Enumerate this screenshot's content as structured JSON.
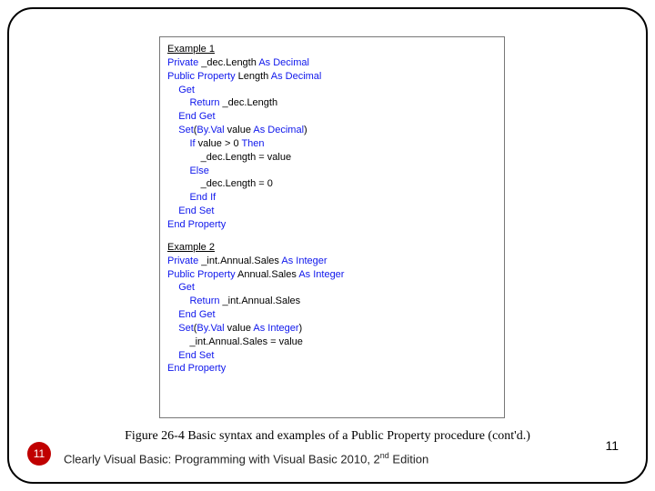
{
  "example1": {
    "heading": "Example 1",
    "lines": [
      [
        [
          "kw",
          "Private "
        ],
        [
          "",
          "_dec.Length "
        ],
        [
          "kw",
          "As Decimal"
        ]
      ],
      [
        [
          "",
          ""
        ]
      ],
      [
        [
          "kw",
          "Public Property "
        ],
        [
          "",
          "Length "
        ],
        [
          "kw",
          "As Decimal"
        ]
      ],
      [
        [
          "",
          "    "
        ],
        [
          "kw",
          "Get"
        ]
      ],
      [
        [
          "",
          "        "
        ],
        [
          "kw",
          "Return "
        ],
        [
          "",
          "_dec.Length"
        ]
      ],
      [
        [
          "",
          "    "
        ],
        [
          "kw",
          "End Get"
        ]
      ],
      [
        [
          "",
          "    "
        ],
        [
          "kw",
          "Set"
        ],
        [
          "",
          "("
        ],
        [
          "kw",
          "By.Val "
        ],
        [
          "",
          "value "
        ],
        [
          "kw",
          "As Decimal"
        ],
        [
          "",
          ")"
        ]
      ],
      [
        [
          "",
          "        "
        ],
        [
          "kw",
          "If "
        ],
        [
          "",
          "value > 0 "
        ],
        [
          "kw",
          "Then"
        ]
      ],
      [
        [
          "",
          "            _dec.Length = value"
        ]
      ],
      [
        [
          "",
          "        "
        ],
        [
          "kw",
          "Else"
        ]
      ],
      [
        [
          "",
          "            _dec.Length = 0"
        ]
      ],
      [
        [
          "",
          "        "
        ],
        [
          "kw",
          "End If"
        ]
      ],
      [
        [
          "",
          "    "
        ],
        [
          "kw",
          "End Set"
        ]
      ],
      [
        [
          "kw",
          "End Property"
        ]
      ]
    ]
  },
  "example2": {
    "heading": "Example 2",
    "lines": [
      [
        [
          "kw",
          "Private "
        ],
        [
          "",
          "_int.Annual.Sales "
        ],
        [
          "kw",
          "As Integer"
        ]
      ],
      [
        [
          "",
          ""
        ]
      ],
      [
        [
          "kw",
          "Public Property "
        ],
        [
          "",
          "Annual.Sales "
        ],
        [
          "kw",
          "As Integer"
        ]
      ],
      [
        [
          "",
          "    "
        ],
        [
          "kw",
          "Get"
        ]
      ],
      [
        [
          "",
          "        "
        ],
        [
          "kw",
          "Return "
        ],
        [
          "",
          "_int.Annual.Sales"
        ]
      ],
      [
        [
          "",
          "    "
        ],
        [
          "kw",
          "End Get"
        ]
      ],
      [
        [
          "",
          "    "
        ],
        [
          "kw",
          "Set"
        ],
        [
          "",
          "("
        ],
        [
          "kw",
          "By.Val "
        ],
        [
          "",
          "value "
        ],
        [
          "kw",
          "As Integer"
        ],
        [
          "",
          ")"
        ]
      ],
      [
        [
          "",
          "        _int.Annual.Sales = value"
        ]
      ],
      [
        [
          "",
          "    "
        ],
        [
          "kw",
          "End Set"
        ]
      ],
      [
        [
          "kw",
          "End Property"
        ]
      ]
    ]
  },
  "caption": "Figure 26-4 Basic syntax and examples of a Public Property procedure (cont'd.)",
  "badge": "11",
  "footer": {
    "prefix": "Clearly Visual Basic: Programming with Visual Basic 2010, 2",
    "sup": "nd",
    "suffix": " Edition"
  },
  "pagenum": "11"
}
